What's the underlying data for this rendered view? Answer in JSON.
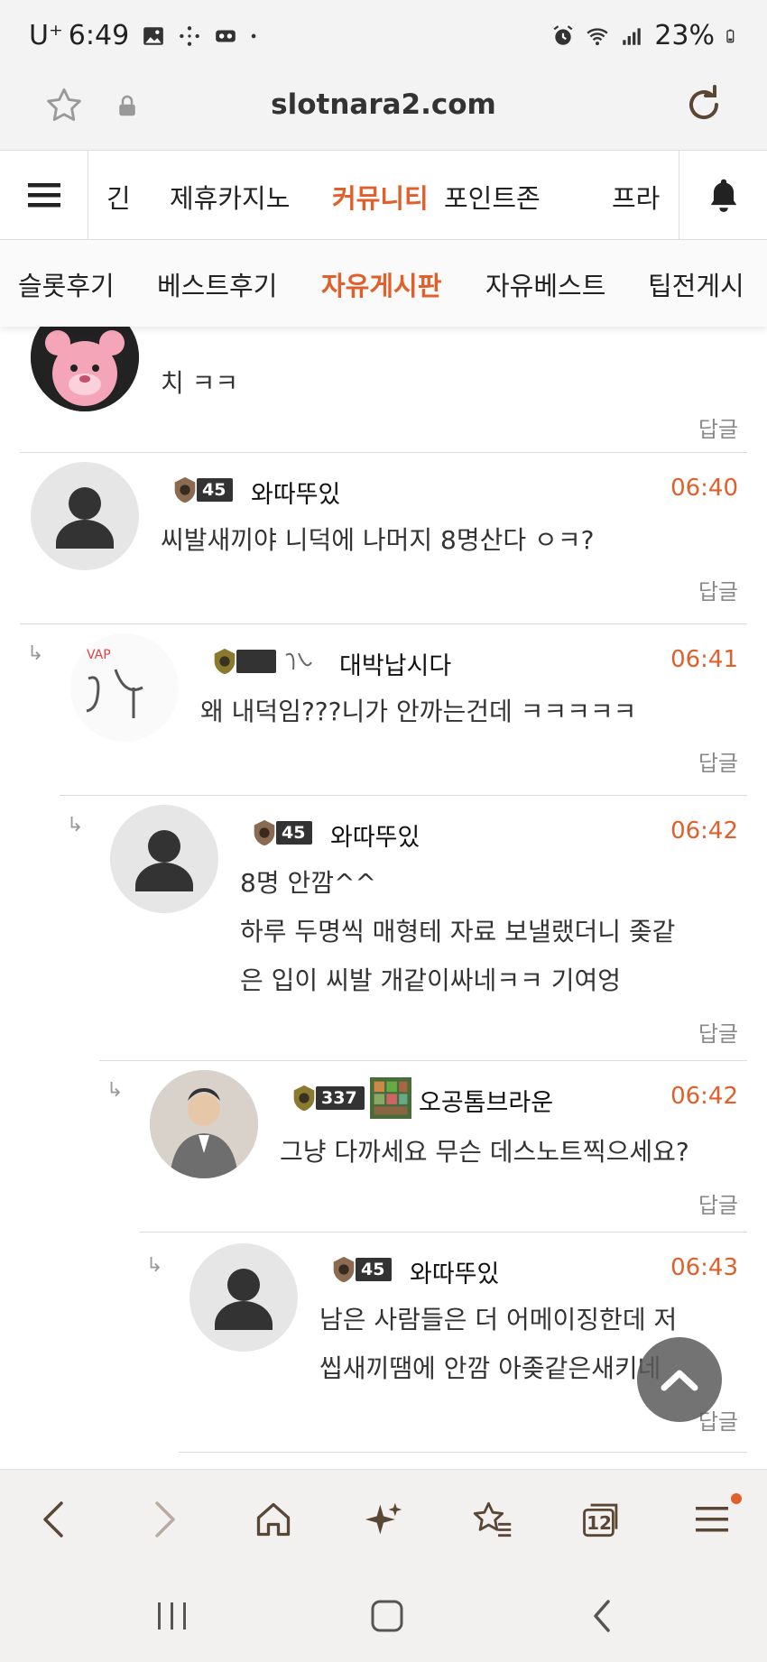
{
  "status_bar": {
    "carrier": "U⁺",
    "time": "6:49",
    "battery": "23%",
    "left_icons": [
      "gallery-icon",
      "sparkle-icon",
      "voicemail-icon",
      "dot-icon"
    ],
    "right_icons": [
      "alarm-icon",
      "wifi-icon",
      "signal-icon",
      "battery-icon"
    ]
  },
  "url_bar": {
    "url": "slotnara2.com"
  },
  "primary_nav": {
    "items": [
      "긴",
      "제휴카지노",
      "커뮤니티",
      "포인트존",
      "프라"
    ],
    "active": "커뮤니티"
  },
  "secondary_nav": {
    "items": [
      "슬롯후기",
      "베스트후기",
      "자유게시판",
      "자유베스트",
      "팁전게시"
    ],
    "active": "자유게시판"
  },
  "reply_label": "답글",
  "comments": [
    {
      "author": "",
      "level": "",
      "time": "",
      "text": "치 ㅋㅋ",
      "avatar": "pink-bear"
    },
    {
      "author": "와따뚜있",
      "level": "45",
      "time": "06:40",
      "text": "씨발새끼야 니덕에 나머지 8명산다 ㅇㅋ?",
      "avatar": "default"
    },
    {
      "author": "대박납시다",
      "level": "",
      "time": "06:41",
      "text": "왜 내덕임???니가 안까는건데 ㅋㅋㅋㅋㅋ",
      "avatar": "drawing"
    },
    {
      "author": "와따뚜있",
      "level": "45",
      "time": "06:42",
      "text_lines": [
        "8명 안깜^^",
        "하루 두명씩 매형테 자료 보낼랬더니 좆같",
        "은 입이 씨발 개같이싸네ㅋㅋ 기여엉"
      ],
      "avatar": "default"
    },
    {
      "author": "오공톰브라운",
      "level": "337",
      "time": "06:42",
      "text": "그냥 다까세요 무슨 데스노트찍으세요?",
      "avatar": "photo"
    },
    {
      "author": "와따뚜있",
      "level": "45",
      "time": "06:43",
      "text_lines": [
        "남은 사람들은 더 어메이징한데 저",
        "씹새끼땜에 안깜 아좆같은새키네"
      ],
      "avatar": "default"
    }
  ],
  "toolbar": {
    "tab_count": "12"
  },
  "colors": {
    "accent": "#e0602c",
    "icon_brown": "#5a4634"
  }
}
